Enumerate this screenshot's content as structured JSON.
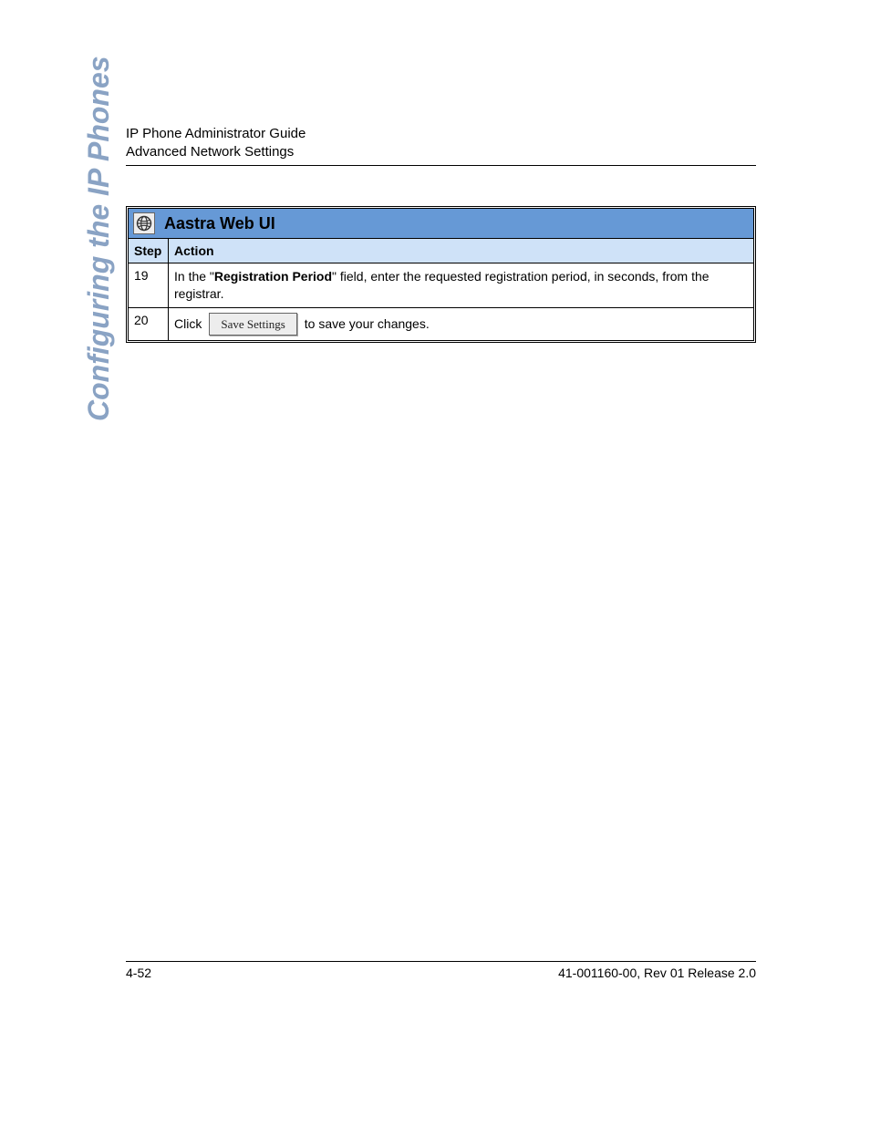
{
  "header": {
    "line1": "IP Phone Administrator Guide",
    "line2": "Advanced Network Settings"
  },
  "side_text": "Configuring the IP Phones",
  "table": {
    "title": "Aastra Web UI",
    "columns": {
      "step": "Step",
      "action": "Action"
    },
    "rows": [
      {
        "step": "19",
        "action_pre": "In the \"",
        "action_bold": "Registration Period",
        "action_post": "\" field, enter the requested registration period, in seconds, from the registrar."
      },
      {
        "step": "20",
        "action_pre": "Click",
        "button_label": "Save Settings",
        "action_post": "to save your changes."
      }
    ]
  },
  "footer": {
    "left": "4-52",
    "right": "41-001160-00, Rev 01  Release 2.0"
  }
}
